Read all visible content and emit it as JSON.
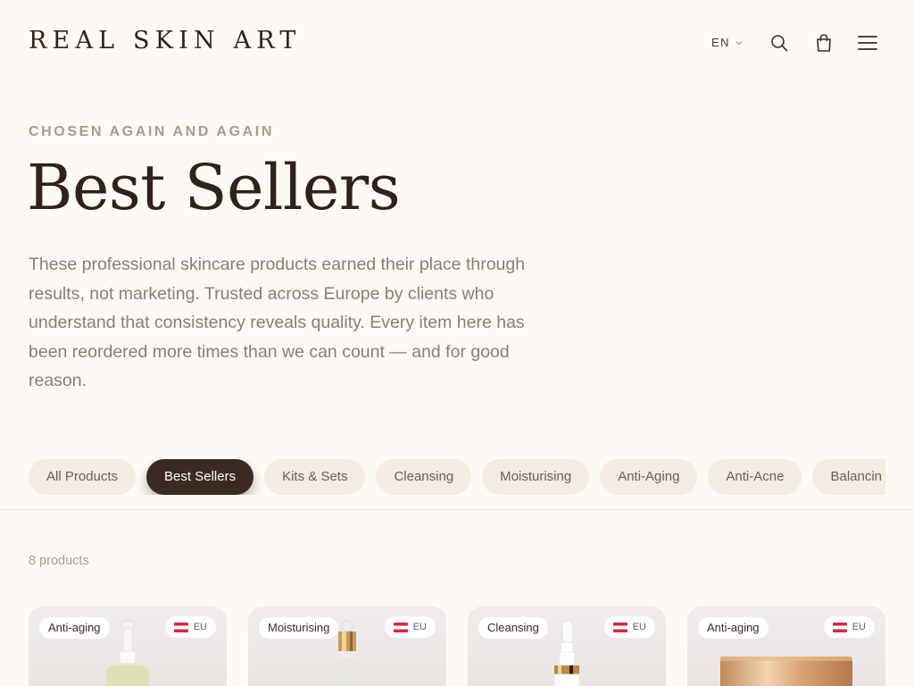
{
  "header": {
    "logo": "REAL SKIN ART",
    "language": "EN",
    "icons": [
      "chevron-down-icon",
      "search-icon",
      "bag-icon",
      "menu-icon"
    ]
  },
  "hero": {
    "eyebrow": "CHOSEN AGAIN AND AGAIN",
    "title": "Best Sellers",
    "description": "These professional skincare products earned their place through results, not marketing. Trusted across Europe by clients who understand that consistency reveals quality. Every item here has been reordered more times than we can count — and for good reason."
  },
  "filters": [
    {
      "label": "All Products",
      "active": false
    },
    {
      "label": "Best Sellers",
      "active": true
    },
    {
      "label": "Kits & Sets",
      "active": false
    },
    {
      "label": "Cleansing",
      "active": false
    },
    {
      "label": "Moisturising",
      "active": false
    },
    {
      "label": "Anti-Aging",
      "active": false
    },
    {
      "label": "Anti-Acne",
      "active": false
    },
    {
      "label": "Balancin",
      "active": false
    }
  ],
  "product_count": "8 products",
  "products": [
    {
      "tag": "Anti-aging",
      "origin": "EU",
      "image": "dropper-bottle-serum"
    },
    {
      "tag": "Moisturising",
      "origin": "EU",
      "image": "dropper-bottle-gold"
    },
    {
      "tag": "Cleansing",
      "origin": "EU",
      "image": "pump-bottle-white"
    },
    {
      "tag": "Anti-aging",
      "origin": "EU",
      "image": "cream-jar-gold"
    }
  ],
  "colors": {
    "background": "#fdf9f5",
    "primary": "#3a2a22",
    "chip": "#f4ebe3",
    "eyebrow": "#ad9a8b",
    "body_text": "#8c7d74",
    "flag_red": "#d7263d"
  }
}
